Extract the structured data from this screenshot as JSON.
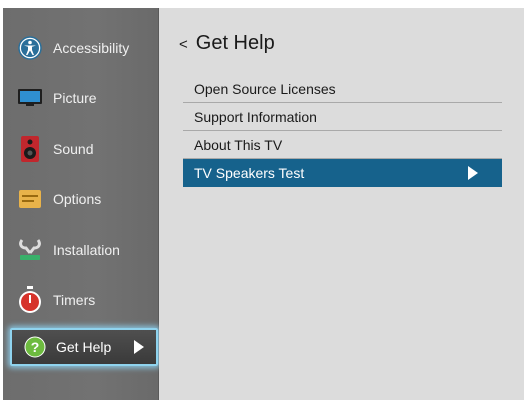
{
  "sidebar": {
    "items": [
      {
        "label": "Accessibility",
        "icon": "accessibility-icon"
      },
      {
        "label": "Picture",
        "icon": "monitor-icon"
      },
      {
        "label": "Sound",
        "icon": "speaker-icon"
      },
      {
        "label": "Options",
        "icon": "options-icon"
      },
      {
        "label": "Installation",
        "icon": "antenna-icon"
      },
      {
        "label": "Timers",
        "icon": "stopwatch-icon"
      },
      {
        "label": "Get Help",
        "icon": "question-icon",
        "selected": true
      }
    ]
  },
  "header": {
    "back_glyph": "<",
    "title": "Get Help"
  },
  "menu": {
    "items": [
      {
        "label": "Open Source Licenses"
      },
      {
        "label": "Support Information"
      },
      {
        "label": "About This TV"
      },
      {
        "label": "TV Speakers Test",
        "selected": true
      }
    ]
  },
  "colors": {
    "sidebar_bg": "#6d6d6d",
    "panel_bg": "#dcdcdc",
    "highlight": "#16628c",
    "focus_glow": "#8fd3ee"
  }
}
